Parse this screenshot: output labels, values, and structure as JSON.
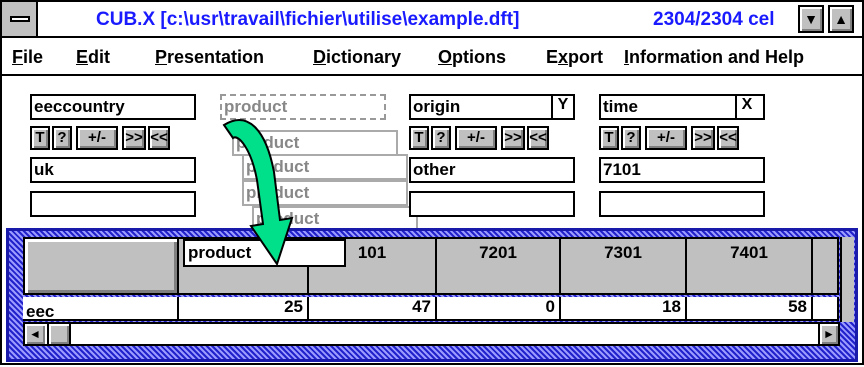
{
  "window": {
    "title": "CUB.X [c:\\usr\\travail\\fichier\\utilise\\example.dft]",
    "cell_count": "2304/2304 cel",
    "minimize_glyph": "▼",
    "maximize_glyph": "▲"
  },
  "menu": [
    {
      "key": "F",
      "rest": "ile"
    },
    {
      "key": "E",
      "rest": "dit"
    },
    {
      "key": "P",
      "rest": "resentation"
    },
    {
      "key": "D",
      "rest": "ictionary"
    },
    {
      "key": "O",
      "rest": "ptions"
    },
    {
      "pre": "E",
      "key": "x",
      "rest": "port"
    },
    {
      "key": "I",
      "rest": "nformation and Help"
    }
  ],
  "dimensions": {
    "eeccountry": {
      "name": "eeccountry",
      "value": "uk"
    },
    "product": {
      "name": "product",
      "ghost1": "product",
      "ghost2": "product",
      "ghost3": "product",
      "ghost4": "product"
    },
    "origin": {
      "name": "origin",
      "flag": "Y",
      "value": "other"
    },
    "time": {
      "name": "time",
      "flag": "X",
      "value": "7101"
    }
  },
  "buttons": {
    "t": "T",
    "q": "?",
    "pm": "+/-",
    "fwd": ">>",
    "back": "<<"
  },
  "grid": {
    "dragged_label": "product",
    "columns": [
      "101",
      "7201",
      "7301",
      "7401"
    ],
    "rows": [
      {
        "label": "eec",
        "values": [
          "25",
          "47",
          "0",
          "18",
          "58"
        ]
      }
    ]
  },
  "scroll": {
    "left_glyph": "◄",
    "right_glyph": "►"
  },
  "colors": {
    "title_text": "#1a1aff",
    "drag_arrow": "#00e08a",
    "grid_frame": "#2222cc"
  }
}
